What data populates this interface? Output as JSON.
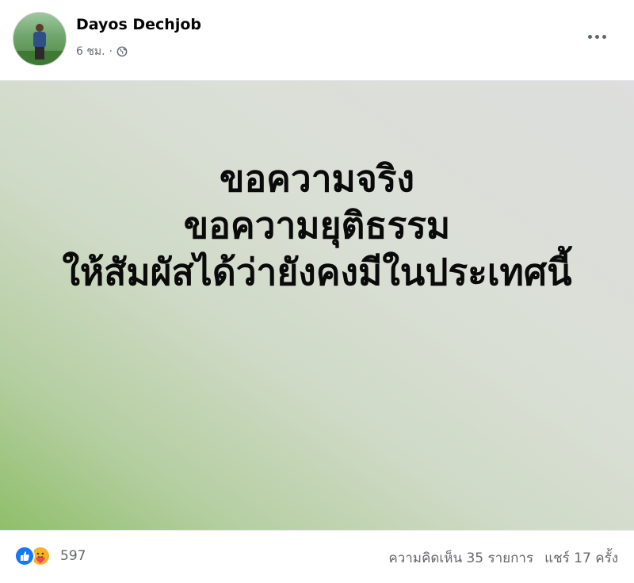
{
  "post": {
    "author": "Dayos Dechjob",
    "time": "6 ชม.",
    "separator": "·",
    "privacy_icon": "globe-icon",
    "more_icon": "more-options-icon",
    "text_lines": [
      "ขอความจริง",
      "ขอความยุติธรรม",
      "ให้สัมผัสได้ว่ายังคงมีในประเทศนี้"
    ],
    "background_colors": [
      "#8fbf6a",
      "#dddedd"
    ]
  },
  "footer": {
    "reaction_icons": [
      "like-icon",
      "care-icon"
    ],
    "reaction_count": "597",
    "comments": "ความคิดเห็น 35 รายการ",
    "shares": "แชร์ 17 ครั้ง"
  },
  "colors": {
    "like": "#1877f2",
    "care": "#f7b125",
    "secondary_text": "#65676b"
  }
}
